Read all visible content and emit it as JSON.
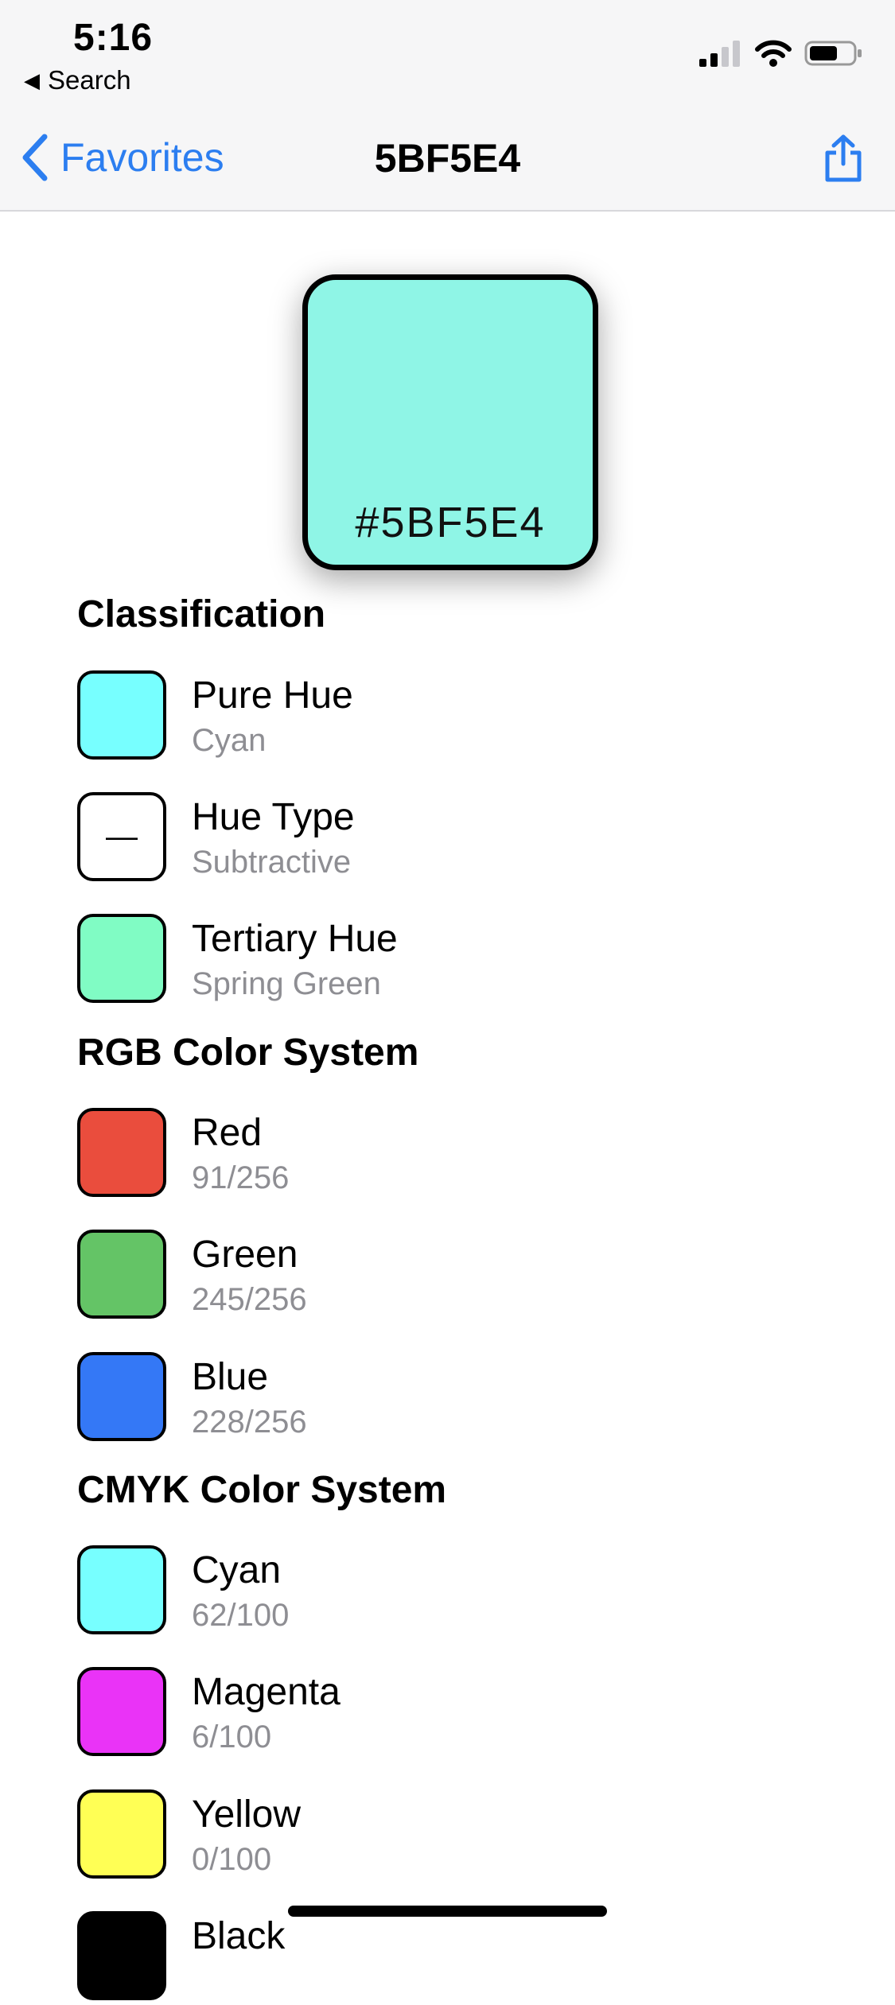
{
  "status": {
    "time": "5:16",
    "back_label": "Search"
  },
  "nav": {
    "back_label": "Favorites",
    "title": "5BF5E4"
  },
  "swatch": {
    "hex": "#5BF5E4",
    "color": "#8ff5e6"
  },
  "sections": {
    "classification": {
      "title": "Classification",
      "rows": [
        {
          "title": "Pure Hue",
          "value": "Cyan",
          "color": "#77ffff"
        },
        {
          "title": "Hue Type",
          "value": "Subtractive",
          "color": "#ffffff",
          "glyph": "—"
        },
        {
          "title": "Tertiary Hue",
          "value": "Spring Green",
          "color": "#80fcc4"
        }
      ]
    },
    "rgb": {
      "title": "RGB Color System",
      "rows": [
        {
          "title": "Red",
          "value": "91/256",
          "color": "#ea4d3d"
        },
        {
          "title": "Green",
          "value": "245/256",
          "color": "#64c466"
        },
        {
          "title": "Blue",
          "value": "228/256",
          "color": "#3478f6"
        }
      ]
    },
    "cmyk": {
      "title": "CMYK Color System",
      "rows": [
        {
          "title": "Cyan",
          "value": "62/100",
          "color": "#77ffff"
        },
        {
          "title": "Magenta",
          "value": "6/100",
          "color": "#ea33f7"
        },
        {
          "title": "Yellow",
          "value": "0/100",
          "color": "#ffff55"
        },
        {
          "title": "Black",
          "value": "",
          "color": "#000000"
        }
      ]
    }
  }
}
